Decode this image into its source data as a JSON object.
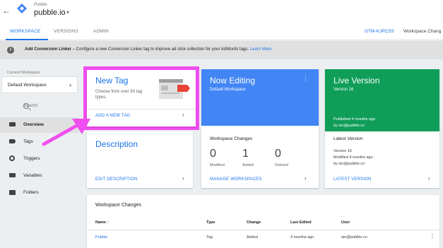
{
  "header": {
    "back_icon": "arrow-left",
    "logo_icon": "gtm-diamond",
    "account_label": "Pubble",
    "container_name": "pubble.io",
    "caret": "▾"
  },
  "tabs": [
    {
      "label": "WORKSPACE",
      "active": true
    },
    {
      "label": "VERSIONS",
      "active": false
    },
    {
      "label": "ADMIN",
      "active": false
    }
  ],
  "container_id": "GTM-KJPCSS",
  "workspace_changes_right": "Workspace Chang",
  "banner": {
    "icon": "info-icon",
    "bold": "Add Conversion Linker",
    "text": " – Configure a new Conversion Linker tag to improve ad click collection for your AdWords tags. ",
    "link": "Learn More"
  },
  "sidebar": {
    "current_workspace_label": "Current Workspace",
    "workspace": "Default Workspace",
    "search_placeholder": "Search",
    "items": [
      {
        "label": "Overview",
        "icon": "overview-icon",
        "active": true
      },
      {
        "label": "Tags",
        "icon": "tag-icon",
        "active": false
      },
      {
        "label": "Triggers",
        "icon": "trigger-icon",
        "active": false
      },
      {
        "label": "Variables",
        "icon": "variables-icon",
        "active": false
      },
      {
        "label": "Folders",
        "icon": "folder-icon",
        "active": false
      }
    ]
  },
  "new_tag": {
    "title": "New Tag",
    "subtitle": "Choose from over 50 tag types.",
    "link": "ADD A NEW TAG"
  },
  "now_editing": {
    "title": "Now Editing",
    "subtitle": "Default Workspace",
    "changes_label": "Workspace Changes",
    "stats": [
      {
        "num": "0",
        "label": "Modified"
      },
      {
        "num": "1",
        "label": "Added"
      },
      {
        "num": "0",
        "label": "Deleted"
      }
    ],
    "link": "MANAGE WORKSPACES"
  },
  "live_version": {
    "title": "Live Version",
    "subtitle": "Version 16",
    "published": "Published 4 months ago",
    "by": "by ian@pubble.co",
    "section_title": "Latest Version",
    "version": "Version 16",
    "modified": "Modified 4 months ago",
    "modified_by": "by ian@pubble.co",
    "link": "LATEST VERSION"
  },
  "description": {
    "title": "Description",
    "link": "EDIT DESCRIPTION"
  },
  "changes_table": {
    "title": "Workspace Changes",
    "columns": [
      "Name ↑",
      "Type",
      "Change",
      "Last Edited",
      "User"
    ],
    "rows": [
      {
        "name": "Pubble",
        "type": "Tag",
        "change": "Added",
        "last_edited": "4 months ago",
        "user": "ian@pubble.co"
      }
    ]
  },
  "colors": {
    "accent": "#1a73e8",
    "editing": "#4285f4",
    "live": "#0f9d58",
    "highlight": "#f04ef0"
  }
}
